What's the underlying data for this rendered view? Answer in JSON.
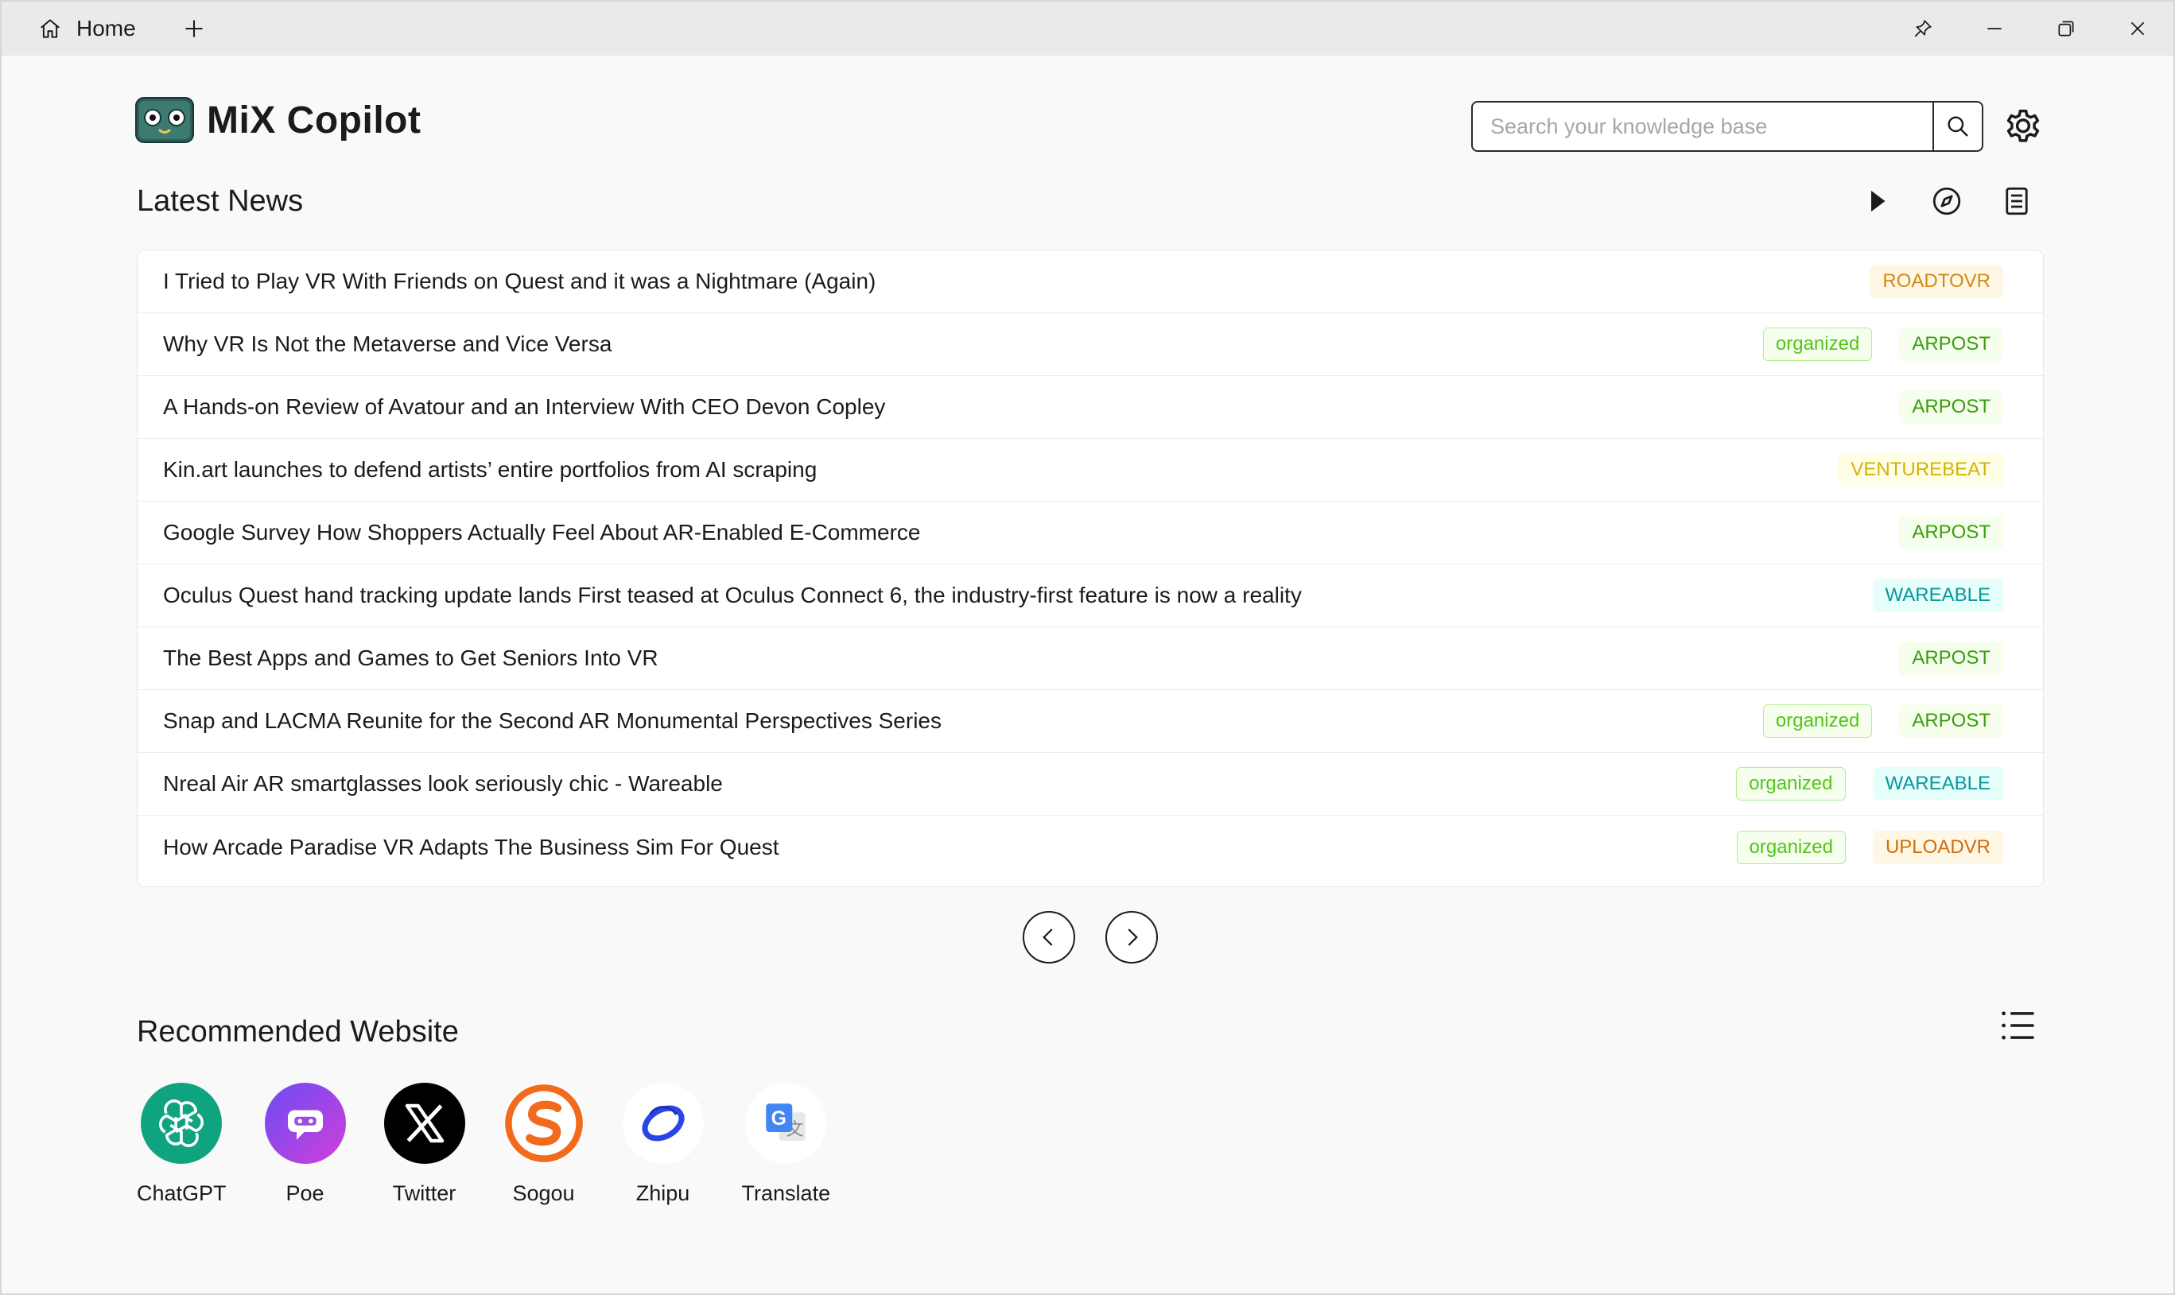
{
  "titlebar": {
    "tab_label": "Home",
    "tab_icon": "home-icon",
    "add_tab_icon": "plus-icon",
    "controls": [
      "pin-icon",
      "minimize-icon",
      "restore-icon",
      "close-icon"
    ]
  },
  "app": {
    "name": "MiX Copilot",
    "logo_icon": "robot-face-logo"
  },
  "search": {
    "placeholder": "Search your knowledge base",
    "value": ""
  },
  "news": {
    "title": "Latest News",
    "tools": [
      "play-icon",
      "compass-icon",
      "document-list-icon"
    ],
    "items": [
      {
        "title": "I Tried to Play VR With Friends on Quest and it was a Nightmare (Again)",
        "organized": false,
        "source": "ROADTOVR"
      },
      {
        "title": "Why VR Is Not the Metaverse and Vice Versa",
        "organized": true,
        "source": "ARPOST"
      },
      {
        "title": "A Hands-on Review of Avatour and an Interview With CEO Devon Copley",
        "organized": false,
        "source": "ARPOST"
      },
      {
        "title": "Kin.art launches to defend artists’ entire portfolios from AI scraping",
        "organized": false,
        "source": "VENTUREBEAT"
      },
      {
        "title": "Google Survey How Shoppers Actually Feel About AR-Enabled E-Commerce",
        "organized": false,
        "source": "ARPOST"
      },
      {
        "title": "Oculus Quest hand tracking update lands First teased at Oculus Connect 6, the industry-first feature is now a reality",
        "organized": false,
        "source": "WAREABLE"
      },
      {
        "title": "The Best Apps and Games to Get Seniors Into VR",
        "organized": false,
        "source": "ARPOST"
      },
      {
        "title": "Snap and LACMA Reunite for the Second AR Monumental Perspectives Series",
        "organized": true,
        "source": "ARPOST"
      },
      {
        "title": "Nreal Air AR smartglasses look seriously chic - Wareable",
        "organized": true,
        "source": "WAREABLE"
      },
      {
        "title": "How Arcade Paradise VR Adapts The Business Sim For Quest",
        "organized": true,
        "source": "UPLOADVR"
      }
    ],
    "organized_label": "organized"
  },
  "pager": {
    "prev_icon": "chevron-left-icon",
    "next_icon": "chevron-right-icon"
  },
  "recommended": {
    "title": "Recommended Website",
    "list_icon": "list-icon",
    "sites": [
      {
        "label": "ChatGPT",
        "icon": "chatgpt-icon",
        "color": "#10a37f"
      },
      {
        "label": "Poe",
        "icon": "poe-icon",
        "color": "#9b4de0"
      },
      {
        "label": "Twitter",
        "icon": "x-icon",
        "color": "#000000"
      },
      {
        "label": "Sogou",
        "icon": "sogou-icon",
        "color": "#f26b1d"
      },
      {
        "label": "Zhipu",
        "icon": "zhipu-icon",
        "color": "#2b45e5"
      },
      {
        "label": "Translate",
        "icon": "translate-icon",
        "color": "#4285f4"
      }
    ]
  }
}
